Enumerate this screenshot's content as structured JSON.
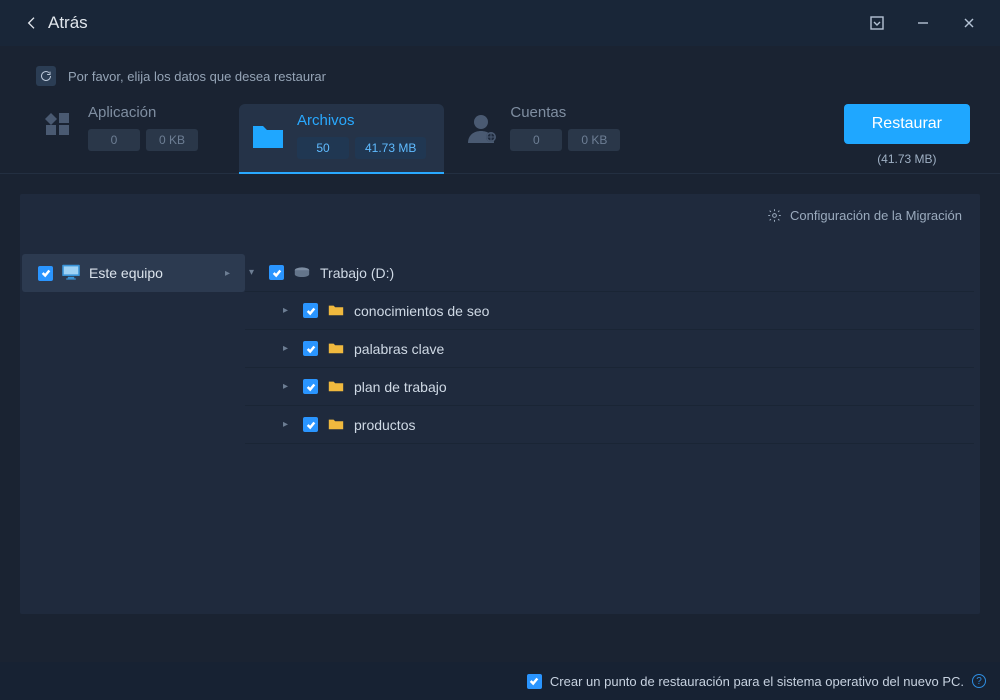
{
  "titlebar": {
    "back_label": "Atrás"
  },
  "notice": "Por favor, elija los datos que desea restaurar",
  "categories": {
    "app": {
      "label": "Aplicación",
      "count": "0",
      "size": "0 KB"
    },
    "files": {
      "label": "Archivos",
      "count": "50",
      "size": "41.73 MB"
    },
    "acct": {
      "label": "Cuentas",
      "count": "0",
      "size": "0 KB"
    }
  },
  "restore": {
    "button": "Restaurar",
    "total": "(41.73 MB)"
  },
  "config_link": "Configuración de la Migración",
  "left_root": "Este equipo",
  "tree": {
    "drive": "Trabajo (D:)",
    "folders": [
      "conocimientos de seo",
      "palabras clave",
      "plan de trabajo",
      "productos"
    ]
  },
  "bottom_text": "Crear un punto de restauración para el sistema operativo del nuevo PC."
}
